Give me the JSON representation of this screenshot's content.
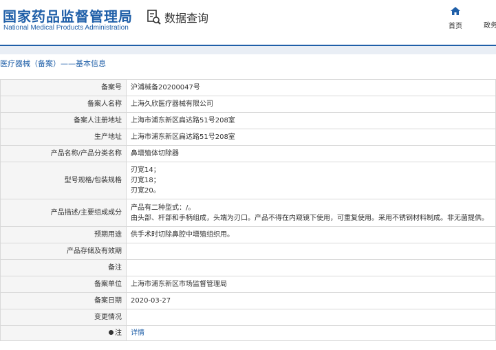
{
  "header": {
    "logo_cn": "国家药品监督管理局",
    "logo_en": "National Medical Products Administration",
    "query_title": "数据查询",
    "nav_home": "首页",
    "nav_policy": "政务"
  },
  "breadcrumb": "医疗器械（备案）——基本信息",
  "colors": {
    "brand": "#1f5fa8",
    "label_bg": "#f5f5f5",
    "border": "#d8d8d8"
  },
  "icons": {
    "query": "document-search-icon",
    "home": "home-icon",
    "note": "pin-icon"
  },
  "table": {
    "rows": [
      {
        "label": "备案号",
        "value": "沪浦械备20200047号"
      },
      {
        "label": "备案人名称",
        "value": "上海久欣医疗器械有限公司"
      },
      {
        "label": "备案人注册地址",
        "value": "上海市浦东新区扁达路51号208室"
      },
      {
        "label": "生产地址",
        "value": "上海市浦东新区扁达路51号208室"
      },
      {
        "label": "产品名称/产品分类名称",
        "value": "鼻增殖体切除器"
      },
      {
        "label": "型号规格/包装规格",
        "lines": [
          "刃宽14；",
          "刃宽18；",
          "刃宽20。"
        ]
      },
      {
        "label": "产品描述/主要组成成分",
        "lines": [
          "产品有二种型式：/。",
          "由头部、杆部和手柄组成，头端为刃口。产品不得在内窥镜下使用，可重复使用。采用不锈钢材料制成。非无菌提供。"
        ]
      },
      {
        "label": "预期用途",
        "value": "供手术时切除鼻腔中增殖组织用。"
      },
      {
        "label": "产品存储及有效期",
        "value": ""
      },
      {
        "label": "备注",
        "value": ""
      },
      {
        "label": "备案单位",
        "value": "上海市浦东新区市场监督管理局"
      },
      {
        "label": "备案日期",
        "value": "2020-03-27"
      },
      {
        "label": "变更情况",
        "value": ""
      },
      {
        "label": "注",
        "value": "详情"
      }
    ]
  }
}
